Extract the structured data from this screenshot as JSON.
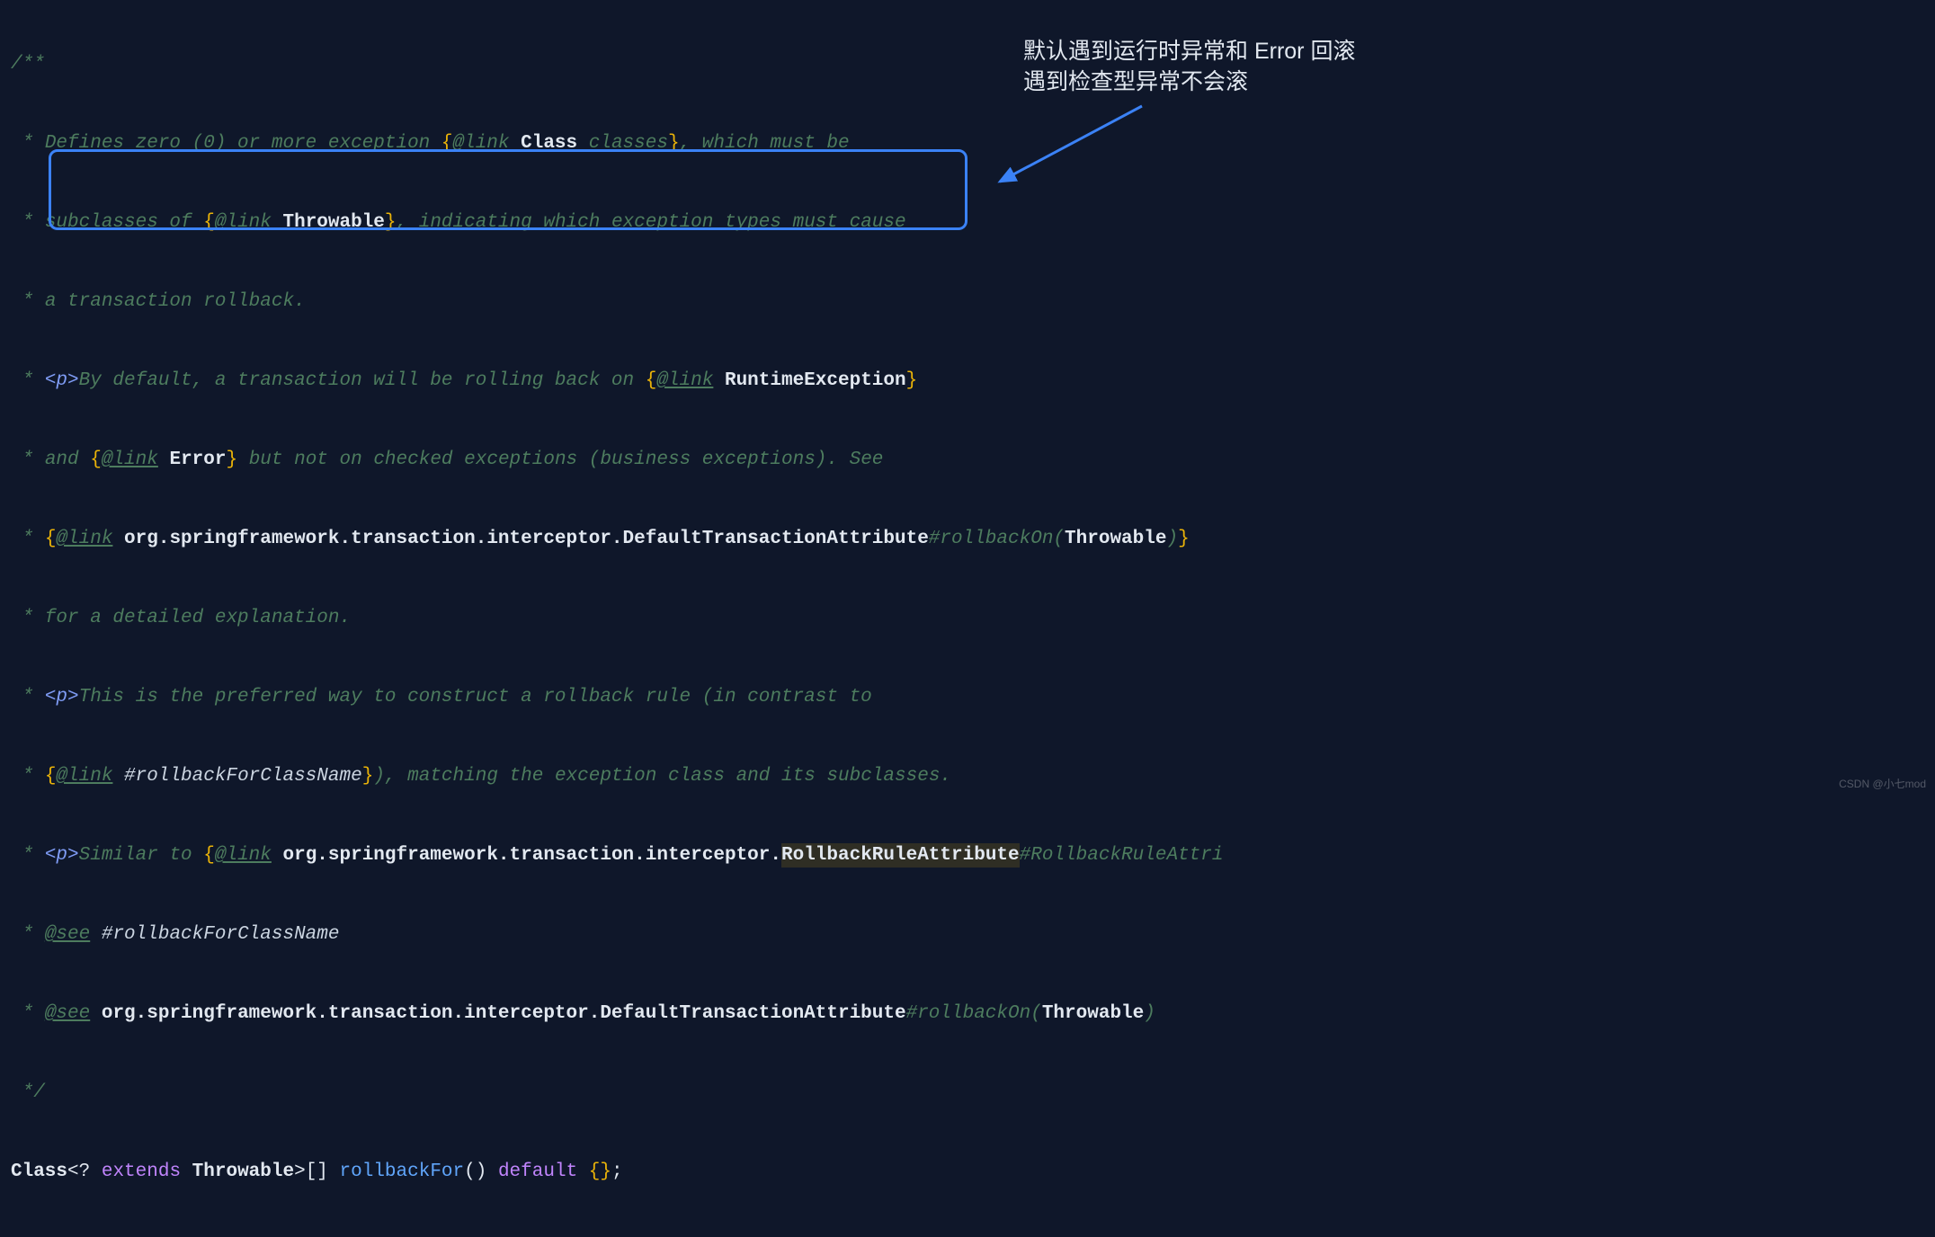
{
  "annotation": {
    "line1": "默认遇到运行时异常和 Error 回滚",
    "line2": "遇到检查型异常不会滚"
  },
  "watermark": "CSDN @小七mod",
  "code": {
    "l0_open": "/**",
    "l1_pre": " * ",
    "l1_a": "Defines zero (0) or more exception ",
    "l1_lb": "{",
    "l1_link": "@link",
    "l1_sp": " ",
    "l1_class": "Class",
    "l1_b": " classes",
    "l1_rb": "}",
    "l1_c": ", which must be",
    "l2_pre": " * ",
    "l2_a": "subclasses of ",
    "l2_lb": "{",
    "l2_link": "@link",
    "l2_sp": " ",
    "l2_class": "Throwable",
    "l2_rb": "}",
    "l2_b": ", indicating which exception types must cause",
    "l3_pre": " * ",
    "l3_a": "a transaction rollback.",
    "l4_pre": " * ",
    "l4_tag": "<p>",
    "l4_a": "By default, a transaction will be rolling back on ",
    "l4_lb": "{",
    "l4_link": "@link",
    "l4_sp": " ",
    "l4_class": "RuntimeException",
    "l4_rb": "}",
    "l5_pre": " * ",
    "l5_a": "and ",
    "l5_lb": "{",
    "l5_link": "@link",
    "l5_sp": " ",
    "l5_class": "Error",
    "l5_rb": "}",
    "l5_b": " but not on checked exceptions (business exceptions). See",
    "l6_pre": " * ",
    "l6_lb": "{",
    "l6_link": "@link",
    "l6_sp": " ",
    "l6_pkg": "org.springframework.transaction.interceptor.DefaultTransactionAttribute",
    "l6_methodref": "#rollbackOn(",
    "l6_arg": "Throwable",
    "l6_close": ")",
    "l6_rb": "}",
    "l7_pre": " * ",
    "l7_a": "for a detailed explanation.",
    "l8_pre": " * ",
    "l8_tag": "<p>",
    "l8_a": "This is the preferred way to construct a rollback rule (in contrast to",
    "l9_pre": " * ",
    "l9_lb": "{",
    "l9_link": "@link",
    "l9_sp": " ",
    "l9_ref": "#rollbackForClassName",
    "l9_rb": "}",
    "l9_a": "), matching the exception class and its subclasses.",
    "l10_pre": " * ",
    "l10_tag": "<p>",
    "l10_a": "Similar to ",
    "l10_lb": "{",
    "l10_link": "@link",
    "l10_sp": " ",
    "l10_pkg": "org.springframework.transaction.interceptor.",
    "l10_hl": "RollbackRuleAttribute",
    "l10_ref": "#RollbackRuleAttri",
    "l11_pre": " * ",
    "l11_see": "@see",
    "l11_sp": " ",
    "l11_ref": "#rollbackForClassName",
    "l12_pre": " * ",
    "l12_see": "@see",
    "l12_sp": " ",
    "l12_pkg": "org.springframework.transaction.interceptor.DefaultTransactionAttribute",
    "l12_ref": "#rollbackOn(",
    "l12_arg": "Throwable",
    "l12_close": ")",
    "l13_close": " */",
    "sig_type": "Class",
    "sig_lt": "<",
    "sig_q": "?",
    "sig_sp1": " ",
    "sig_ext": "extends",
    "sig_sp2": " ",
    "sig_throw": "Throwable",
    "sig_gt": ">",
    "sig_arr": "[] ",
    "sig_method": "rollbackFor",
    "sig_paren": "() ",
    "sig_def": "default",
    "sig_sp3": " ",
    "sig_lb2": "{}",
    "sig_semi": ";"
  }
}
